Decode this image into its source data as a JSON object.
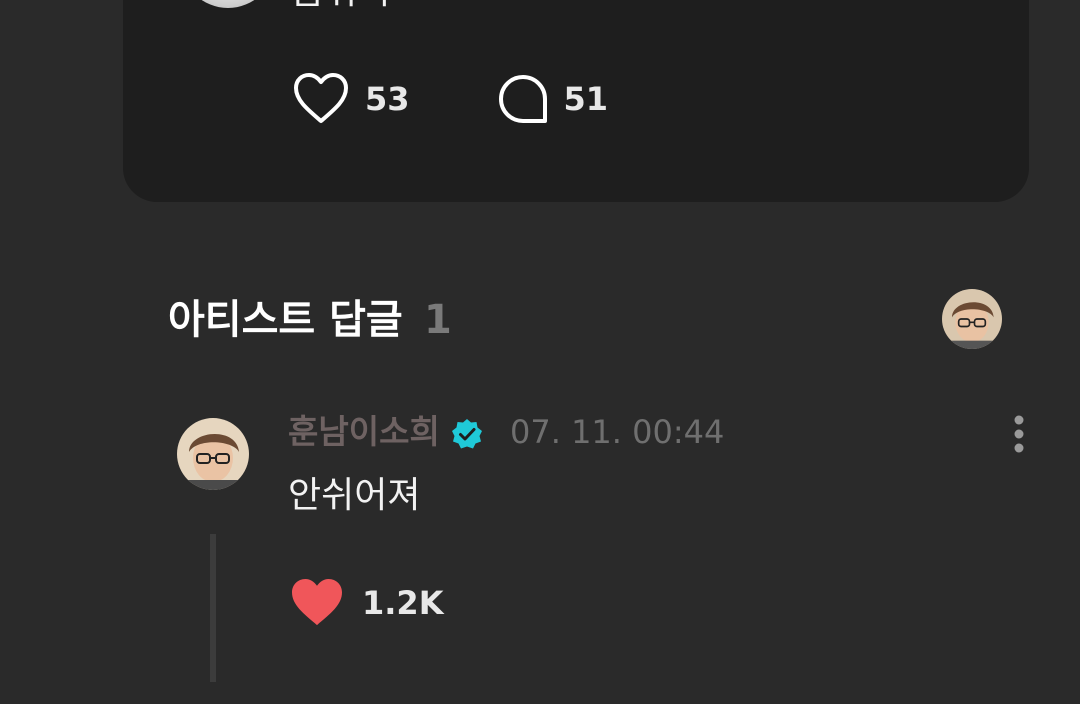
{
  "post": {
    "text": "숨쉬어",
    "like_count": "53",
    "comment_count": "51"
  },
  "artist_replies": {
    "title": "아티스트 답글",
    "count": "1"
  },
  "comment": {
    "author": "훈남이소희",
    "timestamp": "07. 11. 00:44",
    "text": "안쉬어져",
    "like_count": "1.2K"
  },
  "icons": {
    "like": "heart-outline-icon",
    "comment": "speech-bubble-icon",
    "verified": "verified-badge-icon",
    "more": "more-vertical-icon",
    "liked": "heart-filled-icon"
  },
  "colors": {
    "background": "#2a2a2a",
    "card": "#1e1e1e",
    "verified": "#1fc9d8",
    "liked_heart": "#f0565a",
    "author_name": "#6e6262"
  }
}
